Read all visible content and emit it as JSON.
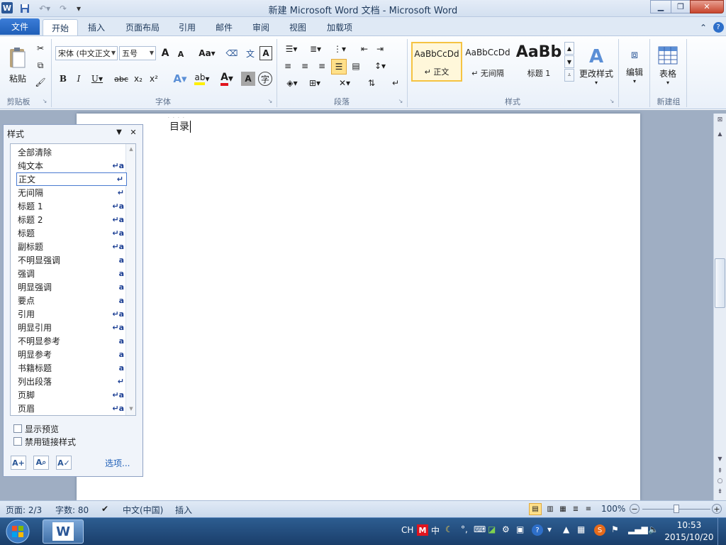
{
  "window": {
    "title": "新建 Microsoft Word 文档 - Microsoft Word"
  },
  "tabs": {
    "file": "文件",
    "home": "开始",
    "insert": "插入",
    "layout": "页面布局",
    "references": "引用",
    "mailings": "邮件",
    "review": "审阅",
    "view": "视图",
    "addins": "加载项"
  },
  "ribbon": {
    "clipboard": {
      "paste": "粘贴",
      "label": "剪贴板"
    },
    "font": {
      "name": "宋体 (中文正文",
      "size": "五号",
      "label": "字体",
      "grow": "A",
      "shrink": "A",
      "case": "Aa",
      "bold": "B",
      "italic": "I",
      "underline": "U",
      "strike": "abc",
      "sub": "x₂",
      "sup": "x²"
    },
    "paragraph": {
      "label": "段落"
    },
    "styles": {
      "label": "样式",
      "items": [
        {
          "sample": "AaBbCcDd",
          "name": "↵ 正文"
        },
        {
          "sample": "AaBbCcDd",
          "name": "↵ 无间隔"
        },
        {
          "sample": "AaBb",
          "name": "标题 1"
        }
      ],
      "change": "更改样式"
    },
    "editing": {
      "label": "编辑"
    },
    "table": {
      "label": "表格",
      "group": "新建组"
    }
  },
  "document": {
    "text": "目录"
  },
  "styles_pane": {
    "title": "样式",
    "items": [
      {
        "name": "全部清除",
        "mark": ""
      },
      {
        "name": "纯文本",
        "mark": "↵a"
      },
      {
        "name": "正文",
        "mark": "↵"
      },
      {
        "name": "无间隔",
        "mark": "↵"
      },
      {
        "name": "标题 1",
        "mark": "↵a"
      },
      {
        "name": "标题 2",
        "mark": "↵a"
      },
      {
        "name": "标题",
        "mark": "↵a"
      },
      {
        "name": "副标题",
        "mark": "↵a"
      },
      {
        "name": "不明显强调",
        "mark": "a"
      },
      {
        "name": "强调",
        "mark": "a"
      },
      {
        "name": "明显强调",
        "mark": "a"
      },
      {
        "name": "要点",
        "mark": "a"
      },
      {
        "name": "引用",
        "mark": "↵a"
      },
      {
        "name": "明显引用",
        "mark": "↵a"
      },
      {
        "name": "不明显参考",
        "mark": "a"
      },
      {
        "name": "明显参考",
        "mark": "a"
      },
      {
        "name": "书籍标题",
        "mark": "a"
      },
      {
        "name": "列出段落",
        "mark": "↵"
      },
      {
        "name": "页脚",
        "mark": "↵a"
      },
      {
        "name": "页眉",
        "mark": "↵a"
      }
    ],
    "show_preview": "显示预览",
    "disable_linked": "禁用链接样式",
    "options": "选项..."
  },
  "status": {
    "page": "页面: 2/3",
    "words": "字数: 80",
    "language": "中文(中国)",
    "mode": "插入",
    "zoom": "100%"
  },
  "taskbar": {
    "ime": "CH",
    "ime_zh": "中",
    "time": "10:53",
    "date": "2015/10/20"
  }
}
